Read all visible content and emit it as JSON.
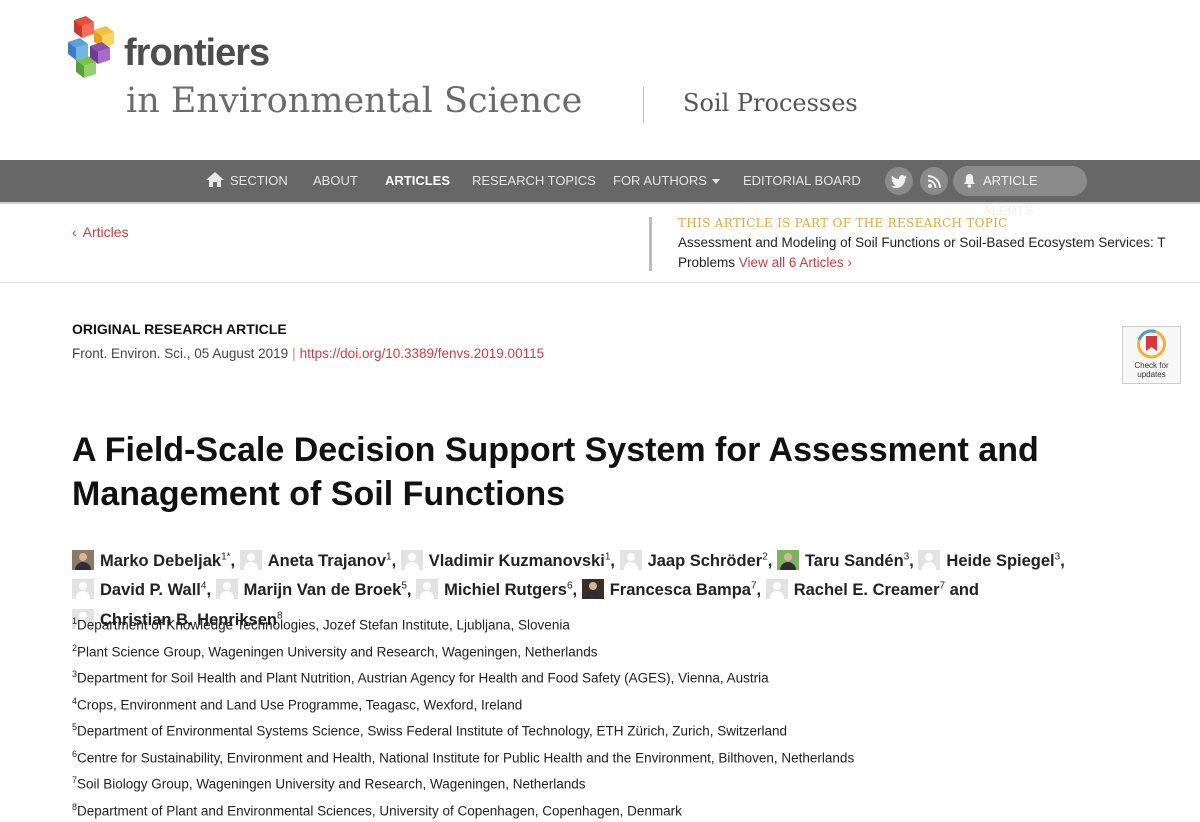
{
  "brand": {
    "name": "frontiers",
    "journal": "in Environmental Science",
    "section": "Soil Processes"
  },
  "nav": {
    "items": [
      {
        "label": "SECTION"
      },
      {
        "label": "ABOUT"
      },
      {
        "label": "ARTICLES",
        "active": true
      },
      {
        "label": "RESEARCH TOPICS"
      },
      {
        "label": "FOR AUTHORS"
      },
      {
        "label": "EDITORIAL BOARD"
      }
    ],
    "alerts_label": "ARTICLE ALERTS",
    "icons": [
      "home-icon",
      "twitter-icon",
      "rss-icon",
      "bell-icon"
    ]
  },
  "back": {
    "label": "Articles"
  },
  "topic": {
    "heading": "THIS ARTICLE IS PART OF THE RESEARCH TOPIC",
    "title_line1": "Assessment and Modeling of Soil Functions or Soil-Based Ecosystem Services: T",
    "title_line2": "Problems",
    "view_all": "View all 6 Articles ›"
  },
  "article": {
    "type": "ORIGINAL RESEARCH ARTICLE",
    "journal_date": "Front. Environ. Sci., 05 August 2019",
    "doi": "https://doi.org/10.3389/fenvs.2019.00115",
    "check_updates": "Check for updates",
    "title": "A Field-Scale Decision Support System for Assessment and Management of Soil Functions"
  },
  "authors": [
    {
      "name": "Marko Debeljak",
      "sup": "1*",
      "suffix": ",",
      "avatar": "photo"
    },
    {
      "name": "Aneta Trajanov",
      "sup": "1",
      "suffix": ",",
      "avatar": "generic"
    },
    {
      "name": "Vladimir Kuzmanovski",
      "sup": "1",
      "suffix": ",",
      "avatar": "generic"
    },
    {
      "name": "Jaap Schröder",
      "sup": "2",
      "suffix": ",",
      "avatar": "generic"
    },
    {
      "name": "Taru Sandén",
      "sup": "3",
      "suffix": ",",
      "avatar": "green"
    },
    {
      "name": "Heide Spiegel",
      "sup": "3",
      "suffix": ",",
      "avatar": "generic"
    },
    {
      "name": "David P. Wall",
      "sup": "4",
      "suffix": ",",
      "avatar": "generic"
    },
    {
      "name": "Marijn Van de Broek",
      "sup": "5",
      "suffix": ",",
      "avatar": "generic"
    },
    {
      "name": "Michiel Rutgers",
      "sup": "6",
      "suffix": ",",
      "avatar": "generic"
    },
    {
      "name": "Francesca Bampa",
      "sup": "7",
      "suffix": ",",
      "avatar": "dark"
    },
    {
      "name": "Rachel E. Creamer",
      "sup": "7",
      "suffix": " and",
      "avatar": "generic"
    },
    {
      "name": "Christian B. Henriksen",
      "sup": "8",
      "suffix": "",
      "avatar": "generic"
    }
  ],
  "affiliations": [
    {
      "num": "1",
      "text": "Department of Knowledge Technologies, Jozef Stefan Institute, Ljubljana, Slovenia"
    },
    {
      "num": "2",
      "text": "Plant Science Group, Wageningen University and Research, Wageningen, Netherlands"
    },
    {
      "num": "3",
      "text": "Department for Soil Health and Plant Nutrition, Austrian Agency for Health and Food Safety (AGES), Vienna, Austria"
    },
    {
      "num": "4",
      "text": "Crops, Environment and Land Use Programme, Teagasc, Wexford, Ireland"
    },
    {
      "num": "5",
      "text": "Department of Environmental Systems Science, Swiss Federal Institute of Technology, ETH Zürich, Zurich, Switzerland"
    },
    {
      "num": "6",
      "text": "Centre for Sustainability, Environment and Health, National Institute for Public Health and the Environment, Bilthoven, Netherlands"
    },
    {
      "num": "7",
      "text": "Soil Biology Group, Wageningen University and Research, Wageningen, Netherlands"
    },
    {
      "num": "8",
      "text": "Department of Plant and Environmental Sciences, University of Copenhagen, Copenhagen, Denmark"
    }
  ],
  "colors": {
    "accent_red": "#d9383a",
    "topic_orange": "#e4a63a",
    "nav_bg": "#676767"
  }
}
